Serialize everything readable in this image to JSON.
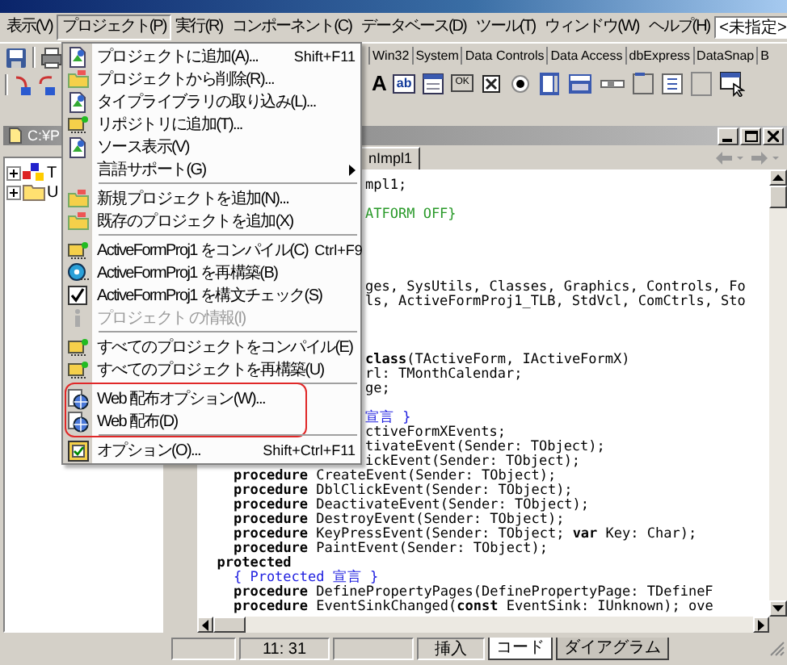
{
  "menubar": {
    "items": [
      {
        "label": "表示(V)",
        "selected": false
      },
      {
        "label": "プロジェクト(P)",
        "selected": true
      },
      {
        "label": "実行(R)",
        "selected": false
      },
      {
        "label": "コンポーネント(C)",
        "selected": false
      },
      {
        "label": "データベース(D)",
        "selected": false
      },
      {
        "label": "ツール(T)",
        "selected": false
      },
      {
        "label": "ウィンドウ(W)",
        "selected": false
      },
      {
        "label": "ヘルプ(H)",
        "selected": false
      }
    ],
    "combo": {
      "value": "<未指定>"
    }
  },
  "palette": {
    "tabs": [
      "Win32",
      "System",
      "Data Controls",
      "Data Access",
      "dbExpress",
      "DataSnap",
      "B"
    ],
    "icons": [
      {
        "kind": "glyph",
        "text": "A"
      },
      {
        "kind": "field",
        "text": "ab"
      },
      {
        "kind": "memo"
      },
      {
        "kind": "button",
        "text": "OK"
      },
      {
        "kind": "checkbox"
      },
      {
        "kind": "radio"
      },
      {
        "kind": "list"
      },
      {
        "kind": "combo"
      },
      {
        "kind": "scrollbar"
      },
      {
        "kind": "group"
      },
      {
        "kind": "radiogroup"
      },
      {
        "kind": "panel"
      },
      {
        "kind": "cursor"
      }
    ]
  },
  "project_menu": {
    "sections": [
      {
        "highlighted": false,
        "items": [
          {
            "label": "プロジェクトに追加(A)...",
            "shortcut": "Shift+F11",
            "disabled": false,
            "submenu": false
          },
          {
            "label": "プロジェクトから削除(R)...",
            "disabled": false,
            "submenu": false
          },
          {
            "label": "タイプライブラリの取り込み(L)...",
            "disabled": false,
            "submenu": false
          },
          {
            "label": "リポジトリに追加(T)...",
            "disabled": false,
            "submenu": false
          },
          {
            "label": "ソース表示(V)",
            "disabled": false,
            "submenu": false
          },
          {
            "label": "言語サポート(G)",
            "disabled": false,
            "submenu": true
          }
        ]
      },
      {
        "highlighted": false,
        "items": [
          {
            "label": "新規プロジェクトを追加(N)...",
            "disabled": false,
            "submenu": false
          },
          {
            "label": "既存のプロジェクトを追加(X)",
            "disabled": false,
            "submenu": false
          }
        ]
      },
      {
        "highlighted": false,
        "items": [
          {
            "label": "ActiveFormProj1 をコンパイル(C)",
            "shortcut": "Ctrl+F9",
            "disabled": false,
            "submenu": false
          },
          {
            "label": "ActiveFormProj1 を再構築(B)",
            "disabled": false,
            "submenu": false
          },
          {
            "label": "ActiveFormProj1 を構文チェック(S)",
            "disabled": false,
            "submenu": false
          },
          {
            "label": "プロジェクト の情報(I)",
            "disabled": true,
            "submenu": false
          }
        ]
      },
      {
        "highlighted": false,
        "items": [
          {
            "label": "すべてのプロジェクトをコンパイル(E)",
            "disabled": false,
            "submenu": false
          },
          {
            "label": "すべてのプロジェクトを再構築(U)",
            "disabled": false,
            "submenu": false
          }
        ]
      },
      {
        "highlighted": true,
        "items": [
          {
            "label": "Web 配布オプション(W)...",
            "disabled": false,
            "submenu": false
          },
          {
            "label": "Web 配布(D)",
            "disabled": false,
            "submenu": false
          }
        ]
      },
      {
        "highlighted": false,
        "items": [
          {
            "label": "オプション(O)...",
            "shortcut": "Shift+Ctrl+F11",
            "disabled": false,
            "submenu": false
          }
        ]
      }
    ]
  },
  "project_panel": {
    "title": "C:¥P",
    "tree": [
      {
        "label": "T",
        "expanded": false
      },
      {
        "label": "U",
        "expanded": false
      }
    ]
  },
  "editor": {
    "tabs": [
      {
        "label": "nImpl1",
        "selected": true
      }
    ],
    "code_lines": [
      {
        "kind": "fragment",
        "text": "mpl1;"
      },
      {
        "kind": "fragment",
        "text": "ATFORM OFF}"
      },
      {
        "kind": "fragment",
        "text": "ges, SysUtils, Classes, Graphics, Controls, Fo"
      },
      {
        "kind": "fragment",
        "text": "ls, ActiveFormProj1_TLB, StdVcl, ComCtrls, Sto"
      },
      {
        "kind": "fragment",
        "text": "**class**(TActiveForm, IActiveFormX)"
      },
      {
        "kind": "fragment",
        "text": "rl: TMonthCalendar;"
      },
      {
        "kind": "fragment",
        "text": "ge;"
      },
      {
        "kind": "fragment",
        "text": "宣言 }"
      },
      {
        "kind": "fragment",
        "text": "ctiveFormXEvents;"
      },
      {
        "kind": "fragment",
        "text": "tivateEvent(Sender: TObject);"
      },
      {
        "kind": "fragment",
        "text": "ickEvent(Sender: TObject);"
      },
      {
        "kind": "full",
        "text": "    **procedure** CreateEvent(Sender: TObject);"
      },
      {
        "kind": "full",
        "text": "    **procedure** DblClickEvent(Sender: TObject);"
      },
      {
        "kind": "full",
        "text": "    **procedure** DeactivateEvent(Sender: TObject);"
      },
      {
        "kind": "full",
        "text": "    **procedure** DestroyEvent(Sender: TObject);"
      },
      {
        "kind": "full",
        "text": "    **procedure** KeyPressEvent(Sender: TObject; **var** Key: Char);"
      },
      {
        "kind": "full",
        "text": "    **procedure** PaintEvent(Sender: TObject);"
      },
      {
        "kind": "full",
        "text": "  protected"
      },
      {
        "kind": "full",
        "text": "    { Protected 宣言 }"
      },
      {
        "kind": "full",
        "text": "    **procedure** DefinePropertyPages(DefinePropertyPage: TDefineF"
      },
      {
        "kind": "full",
        "text": "    **procedure** EventSinkChanged(**const** EventSink: IUnknown); ove"
      }
    ]
  },
  "status_bar": {
    "position": "11: 31",
    "mode": "挿入",
    "view_tabs": [
      {
        "label": "コード",
        "selected": true
      },
      {
        "label": "ダイアグラム",
        "selected": false
      }
    ]
  }
}
